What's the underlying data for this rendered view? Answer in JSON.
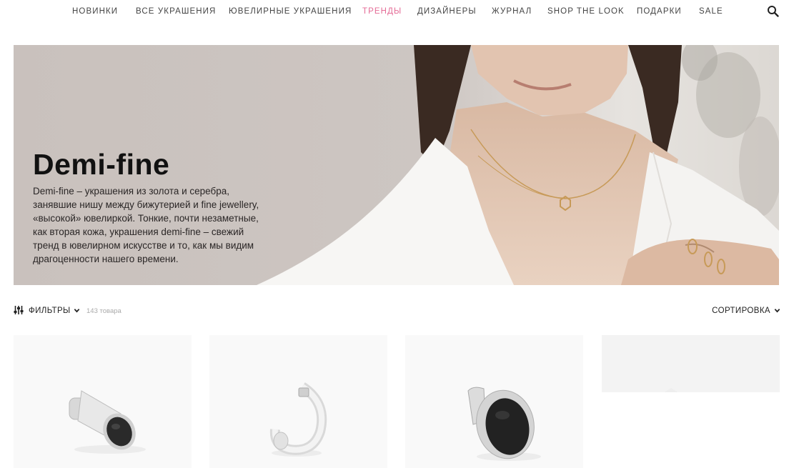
{
  "nav": {
    "items": [
      {
        "label": "НОВИНКИ"
      },
      {
        "label": "ВСЕ УКРАШЕНИЯ"
      },
      {
        "label": "ЮВЕЛИРНЫЕ УКРАШЕНИЯ"
      },
      {
        "label": "ТРЕНДЫ",
        "active": true
      },
      {
        "label": "ДИЗАЙНЕРЫ"
      },
      {
        "label": "ЖУРНАЛ"
      },
      {
        "label": "SHOP THE LOOK"
      },
      {
        "label": "ПОДАРКИ"
      },
      {
        "label": "SALE"
      }
    ],
    "active_color": "#e46b96",
    "search_icon": "search-icon"
  },
  "hero": {
    "title": "Demi-fine",
    "description": "Demi-fine – украшения из золота и серебра, занявшие нишу между бижутерией и fine jewellery, «высокой» ювелиркой. Тонкие, почти незаметные, как вторая кожа, украшения demi-fine – свежий тренд в ювелирном искусстве и то, как мы видим драгоценности нашего времени.",
    "background_color": "#c9c1bd"
  },
  "toolbar": {
    "filter_label": "ФИЛЬТРЫ",
    "count": "143 товара",
    "sort_label": "СОРТИРОВКА"
  },
  "products": [
    {
      "image": "silver-earring-black-pave-side"
    },
    {
      "image": "silver-hoop-earring"
    },
    {
      "image": "silver-earring-black-pave-oval"
    },
    {
      "image": "blank-loading"
    }
  ]
}
